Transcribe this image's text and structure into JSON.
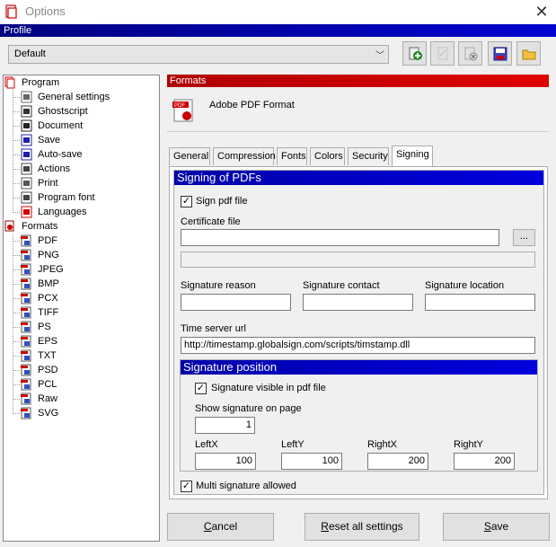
{
  "window": {
    "title": "Options",
    "close_label": "✕"
  },
  "profile": {
    "header": "Profile",
    "selected": "Default",
    "toolbar_icons": [
      "add-profile-icon",
      "rename-profile-icon",
      "delete-profile-icon",
      "save-profile-icon",
      "open-folder-icon"
    ]
  },
  "tree": {
    "program_label": "Program",
    "program_items": [
      "General settings",
      "Ghostscript",
      "Document",
      "Save",
      "Auto-save",
      "Actions",
      "Print",
      "Program font",
      "Languages"
    ],
    "formats_label": "Formats",
    "format_items": [
      "PDF",
      "PNG",
      "JPEG",
      "BMP",
      "PCX",
      "TIFF",
      "PS",
      "EPS",
      "TXT",
      "PSD",
      "PCL",
      "Raw",
      "SVG"
    ]
  },
  "formats": {
    "header": "Formats",
    "name": "Adobe PDF Format"
  },
  "tabs": [
    "General",
    "Compression",
    "Fonts",
    "Colors",
    "Security",
    "Signing"
  ],
  "active_tab": "Signing",
  "signing": {
    "group_title": "Signing of PDFs",
    "sign_pdf_label": "Sign pdf file",
    "sign_pdf_checked": true,
    "certificate_label": "Certificate file",
    "certificate_value": "",
    "browse_label": "...",
    "certificate_info": "",
    "reason_label": "Signature reason",
    "reason_value": "",
    "contact_label": "Signature contact",
    "contact_value": "",
    "location_label": "Signature location",
    "location_value": "",
    "timeserver_label": "Time server url",
    "timeserver_value": "http://timestamp.globalsign.com/scripts/timstamp.dll",
    "position": {
      "title": "Signature position",
      "visible_label": "Signature visible in pdf file",
      "visible_checked": true,
      "page_label": "Show signature on page",
      "page_value": "1",
      "leftx_label": "LeftX",
      "leftx_value": "100",
      "lefty_label": "LeftY",
      "lefty_value": "100",
      "rightx_label": "RightX",
      "rightx_value": "200",
      "righty_label": "RightY",
      "righty_value": "200"
    },
    "multi_label": "Multi signature allowed",
    "multi_checked": true
  },
  "buttons": {
    "cancel_first": "C",
    "cancel_rest": "ancel",
    "reset_first": "R",
    "reset_rest": "eset all settings",
    "save_first": "S",
    "save_rest": "ave"
  },
  "colors": {
    "profile_bar": "#000080",
    "formats_bar": "#c00000",
    "group_title": "#0000cc"
  }
}
